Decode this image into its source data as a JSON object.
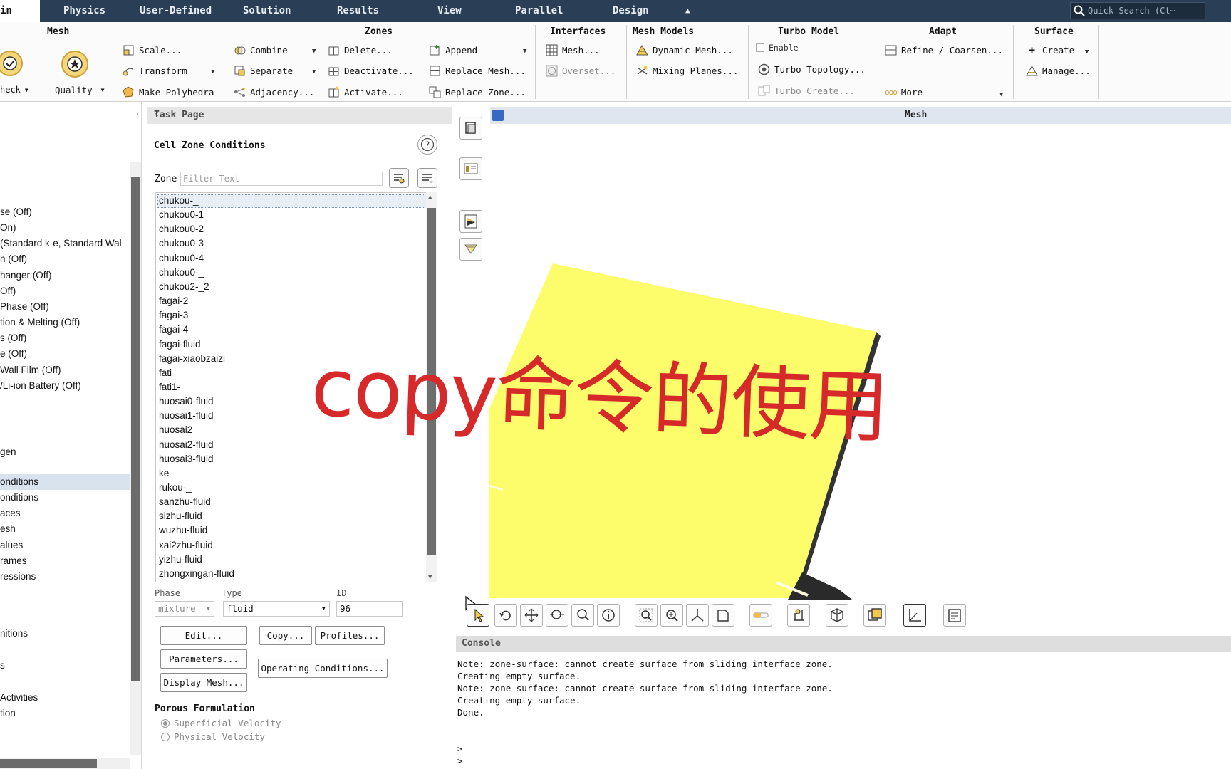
{
  "menubar": {
    "home_label": "in",
    "tabs": [
      "Physics",
      "User-Defined",
      "Solution",
      "Results",
      "View",
      "Parallel",
      "Design"
    ],
    "collapse_glyph": "▲",
    "search_placeholder": "Quick Search (Ct⋯"
  },
  "ribbon": {
    "mesh": {
      "title": "Mesh",
      "check": "heck",
      "quality": "Quality",
      "scale": "Scale...",
      "transform": "Transform",
      "make_polyhedra": "Make Polyhedra"
    },
    "zones": {
      "title": "Zones",
      "combine": "Combine",
      "separate": "Separate",
      "adjacency": "Adjacency...",
      "delete": "Delete...",
      "deactivate": "Deactivate...",
      "activate": "Activate...",
      "append": "Append",
      "replace_mesh": "Replace Mesh...",
      "replace_zone": "Replace Zone..."
    },
    "interfaces": {
      "title": "Interfaces",
      "mesh": "Mesh...",
      "overset": "Overset..."
    },
    "mesh_models": {
      "title": "Mesh Models",
      "dynamic_mesh": "Dynamic Mesh...",
      "mixing_planes": "Mixing Planes..."
    },
    "turbo_model": {
      "title": "Turbo Model",
      "enable": "Enable",
      "turbo_topology": "Turbo Topology...",
      "turbo_create": "Turbo Create..."
    },
    "adapt": {
      "title": "Adapt",
      "refine": "Refine / Coarsen...",
      "more": "More"
    },
    "surface": {
      "title": "Surface",
      "create": "Create",
      "manage": "Manage..."
    }
  },
  "tree": {
    "items": [
      "se (Off)",
      "On)",
      "(Standard k-e, Standard Wal",
      "n (Off)",
      "hanger (Off)",
      "Off)",
      "Phase (Off)",
      "tion & Melting (Off)",
      "s (Off)",
      "e (Off)",
      "Wall Film (Off)",
      "/Li-ion Battery (Off)",
      "gen",
      "onditions",
      "onditions",
      "aces",
      "esh",
      "alues",
      "rames",
      "ressions",
      "nitions",
      "s",
      "Activities",
      "tion"
    ]
  },
  "task_page": {
    "header": "Task Page",
    "title": "Cell Zone Conditions",
    "zone_label": "Zone",
    "filter_placeholder": "Filter Text",
    "zones": [
      "chukou-_",
      "chukou0-1",
      "chukou0-2",
      "chukou0-3",
      "chukou0-4",
      "chukou0-_",
      "chukou2-_2",
      "fagai-2",
      "fagai-3",
      "fagai-4",
      "fagai-fluid",
      "fagai-xiaobzaizi",
      "fati",
      "fati1-_",
      "huosai0-fluid",
      "huosai1-fluid",
      "huosai2",
      "huosai2-fluid",
      "huosai3-fluid",
      "ke-_",
      "rukou-_",
      "sanzhu-fluid",
      "sizhu-fluid",
      "wuzhu-fluid",
      "xai2zhu-fluid",
      "yizhu-fluid",
      "zhongxingan-fluid"
    ],
    "phase_label": "Phase",
    "phase_value": "mixture",
    "type_label": "Type",
    "type_value": "fluid",
    "id_label": "ID",
    "id_value": "96",
    "buttons": {
      "edit": "Edit...",
      "copy": "Copy...",
      "profiles": "Profiles...",
      "parameters": "Parameters...",
      "operating_conditions": "Operating Conditions...",
      "display_mesh": "Display Mesh..."
    },
    "porous_title": "Porous Formulation",
    "porous_options": [
      "Superficial Velocity",
      "Physical Velocity"
    ]
  },
  "graphics": {
    "title": "Mesh",
    "shape_color": "#fdfc6a"
  },
  "console": {
    "header": "Console",
    "lines": [
      "Note: zone-surface: cannot create surface from sliding interface zone.",
      "Creating empty surface.",
      "Note: zone-surface: cannot create surface from sliding interface zone.",
      "Creating empty surface.",
      "Done.",
      ">",
      ">"
    ]
  },
  "overlay": {
    "caption": "copy命令的使用",
    "color": "#d62a2a"
  }
}
